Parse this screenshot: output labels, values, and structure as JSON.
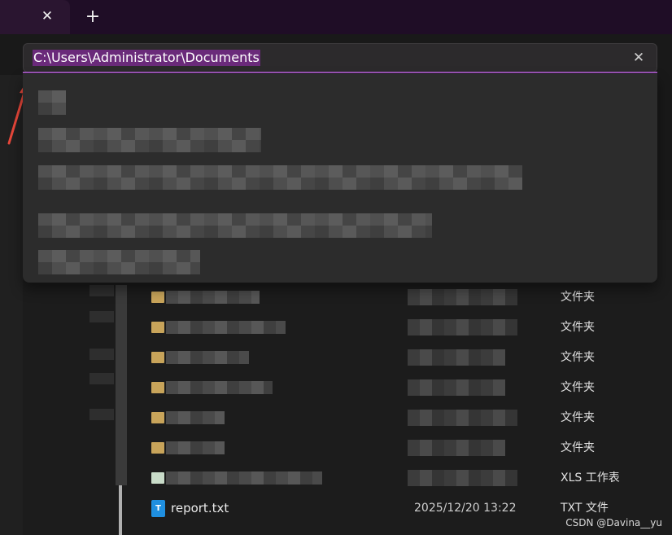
{
  "tabs": {
    "close_glyph": "✕",
    "new_tab_glyph": "+"
  },
  "address_bar": {
    "value": "C:\\Users\\Administrator\\Documents",
    "clear_glyph": "✕"
  },
  "file_list": {
    "folder_type": "文件夹",
    "rows": [
      {
        "type": "文件夹"
      },
      {
        "type": "文件夹"
      },
      {
        "type": "文件夹"
      },
      {
        "type": "文件夹"
      },
      {
        "type": "文件夹"
      },
      {
        "type": "文件夹"
      },
      {
        "type": "XLS 工作表"
      }
    ],
    "file": {
      "icon_letter": "T",
      "name": "report.txt",
      "date": "2025/12/20 13:22",
      "type": "TXT 文件"
    }
  },
  "watermark": "CSDN @Davina__yu",
  "colors": {
    "accent": "#9c55b8",
    "selection": "#6a2a7a",
    "folder": "#c8a45a",
    "arrow": "#e8473a"
  }
}
